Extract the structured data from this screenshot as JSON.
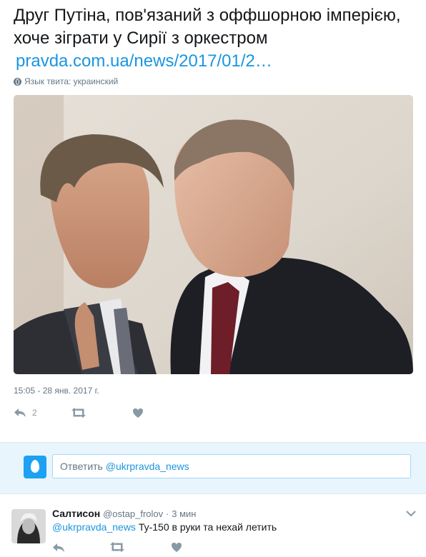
{
  "tweet": {
    "text": "Друг Путіна, пов'язаний з оффшорною імперією, хоче зіграти у Сирії з оркестром",
    "link": "pravda.com.ua/news/2017/01/2…",
    "language_label": "Язык твита: украинский",
    "timestamp": "15:05 - 28 янв. 2017 г.",
    "reply_count": "2",
    "icons": [
      "globe-icon",
      "reply-icon",
      "retweet-icon",
      "like-icon"
    ]
  },
  "reply_box": {
    "prompt": "Ответить",
    "mention": "@ukrpravda_news"
  },
  "reply": {
    "name": "Салтисон",
    "handle": "@ostap_frolov",
    "separator": "·",
    "time": "3 мин",
    "mention": "@ukrpravda_news",
    "text": "Ту-150 в руки та нехай летить"
  },
  "colors": {
    "link": "#1b95e0",
    "muted": "#657786",
    "icon": "#8899a6",
    "reply_bg": "#e8f5fd"
  }
}
